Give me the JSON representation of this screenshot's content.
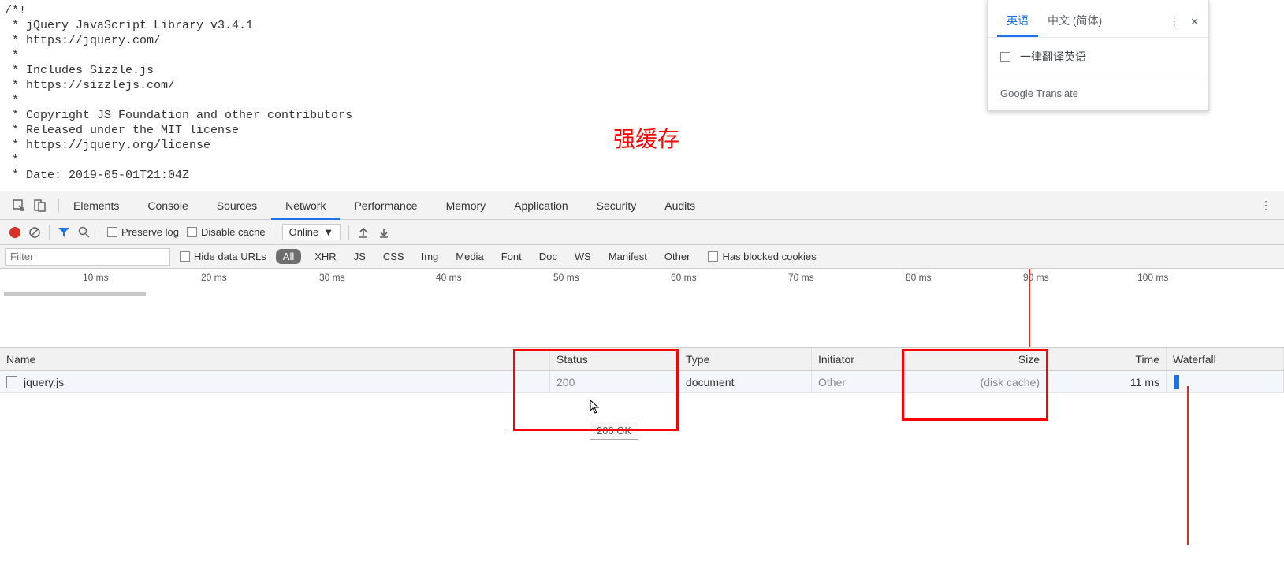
{
  "source": "/*!\n * jQuery JavaScript Library v3.4.1\n * https://jquery.com/\n *\n * Includes Sizzle.js\n * https://sizzlejs.com/\n *\n * Copyright JS Foundation and other contributors\n * Released under the MIT license\n * https://jquery.org/license\n *\n * Date: 2019-05-01T21:04Z",
  "annotation": "强缓存",
  "translate": {
    "tab_en": "英语",
    "tab_zh": "中文 (简体)",
    "always_translate": "一律翻译英语",
    "footer": "Google Translate"
  },
  "devtools_tabs": {
    "elements": "Elements",
    "console": "Console",
    "sources": "Sources",
    "network": "Network",
    "performance": "Performance",
    "memory": "Memory",
    "application": "Application",
    "security": "Security",
    "audits": "Audits"
  },
  "toolbar": {
    "preserve_log": "Preserve log",
    "disable_cache": "Disable cache",
    "throttling": "Online"
  },
  "filterbar": {
    "filter_placeholder": "Filter",
    "hide_data_urls": "Hide data URLs",
    "types": {
      "all": "All",
      "xhr": "XHR",
      "js": "JS",
      "css": "CSS",
      "img": "Img",
      "media": "Media",
      "font": "Font",
      "doc": "Doc",
      "ws": "WS",
      "manifest": "Manifest",
      "other": "Other"
    },
    "blocked_cookies": "Has blocked cookies"
  },
  "timeline": {
    "ticks": [
      "10 ms",
      "20 ms",
      "30 ms",
      "40 ms",
      "50 ms",
      "60 ms",
      "70 ms",
      "80 ms",
      "90 ms",
      "100 ms"
    ]
  },
  "table": {
    "headers": {
      "name": "Name",
      "status": "Status",
      "type": "Type",
      "initiator": "Initiator",
      "size": "Size",
      "time": "Time",
      "waterfall": "Waterfall"
    },
    "row": {
      "name": "jquery.js",
      "status": "200",
      "type": "document",
      "initiator": "Other",
      "size": "(disk cache)",
      "time": "11 ms"
    }
  },
  "tooltip": "200 OK"
}
